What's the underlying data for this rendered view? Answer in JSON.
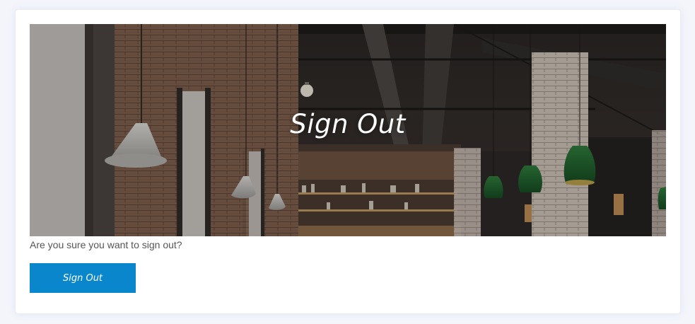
{
  "hero": {
    "title": "Sign Out",
    "background_image": "industrial-brick-restaurant-interior"
  },
  "confirm": {
    "message": "Are you sure you want to sign out?",
    "button_label": "Sign Out"
  },
  "colors": {
    "page_background": "#f3f5fb",
    "card_background": "#ffffff",
    "button": "#0a87cc",
    "text": "#555555"
  }
}
